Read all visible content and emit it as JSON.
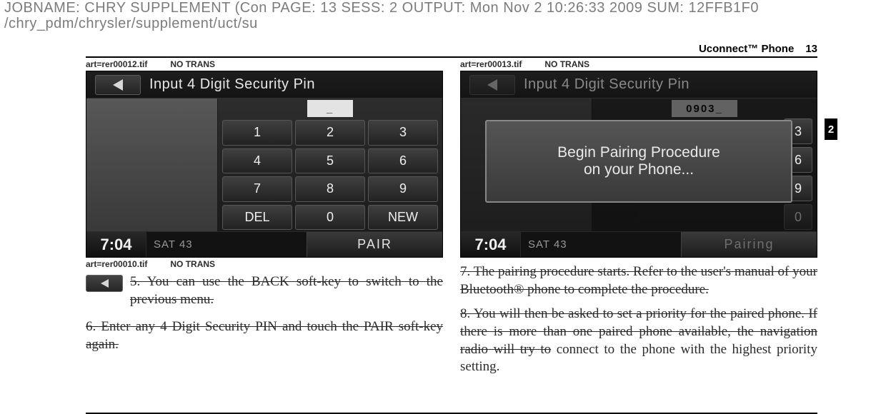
{
  "job_header": {
    "line1": "JOBNAME: CHRY SUPPLEMENT (Con  PAGE: 13  SESS: 2  OUTPUT: Mon Nov  2 10:26:33 2009  SUM: 12FFB1F0",
    "line2": "/chry_pdm/chrysler/supplement/uct/su"
  },
  "page": {
    "section": "Uconnect™ Phone",
    "number": "13",
    "side_tab": "2"
  },
  "left": {
    "art_top": {
      "file": "art=rer00012.tif",
      "trans": "NO TRANS"
    },
    "art_bottom": {
      "file": "art=rer00010.tif",
      "trans": "NO TRANS"
    },
    "screen": {
      "title": "Input 4 Digit Security Pin",
      "input_value": "_",
      "keys": [
        "1",
        "2",
        "3",
        "4",
        "5",
        "6",
        "7",
        "8",
        "9",
        "DEL",
        "0",
        "NEW"
      ],
      "clock": "7:04",
      "sat": "SAT 43",
      "foot_btn": "PAIR"
    },
    "step5": "5.   You can use the BACK soft-key to switch to the previous menu.",
    "step6": "6. Enter any 4 Digit Security PIN and touch the PAIR soft-key again."
  },
  "right": {
    "art_top": {
      "file": "art=rer00013.tif",
      "trans": "NO TRANS"
    },
    "screen": {
      "title": "Input 4 Digit Security Pin",
      "input_value": "0903_",
      "keys_right": [
        "3",
        "6",
        "9"
      ],
      "key_bottom": "0",
      "dialog_l1": "Begin Pairing Procedure",
      "dialog_l2": "on your Phone...",
      "clock": "7:04",
      "sat": "SAT 43",
      "foot_btn": "Pairing"
    },
    "step7": "7. The pairing procedure starts. Refer to the user's manual of your Bluetooth® phone to complete the procedure.",
    "step8a": "8.  You will then be asked to set a priority for the paired phone. If there is more than one paired phone available, the navigation radio will try to",
    "step8b": " connect to the phone with the highest priority setting."
  }
}
